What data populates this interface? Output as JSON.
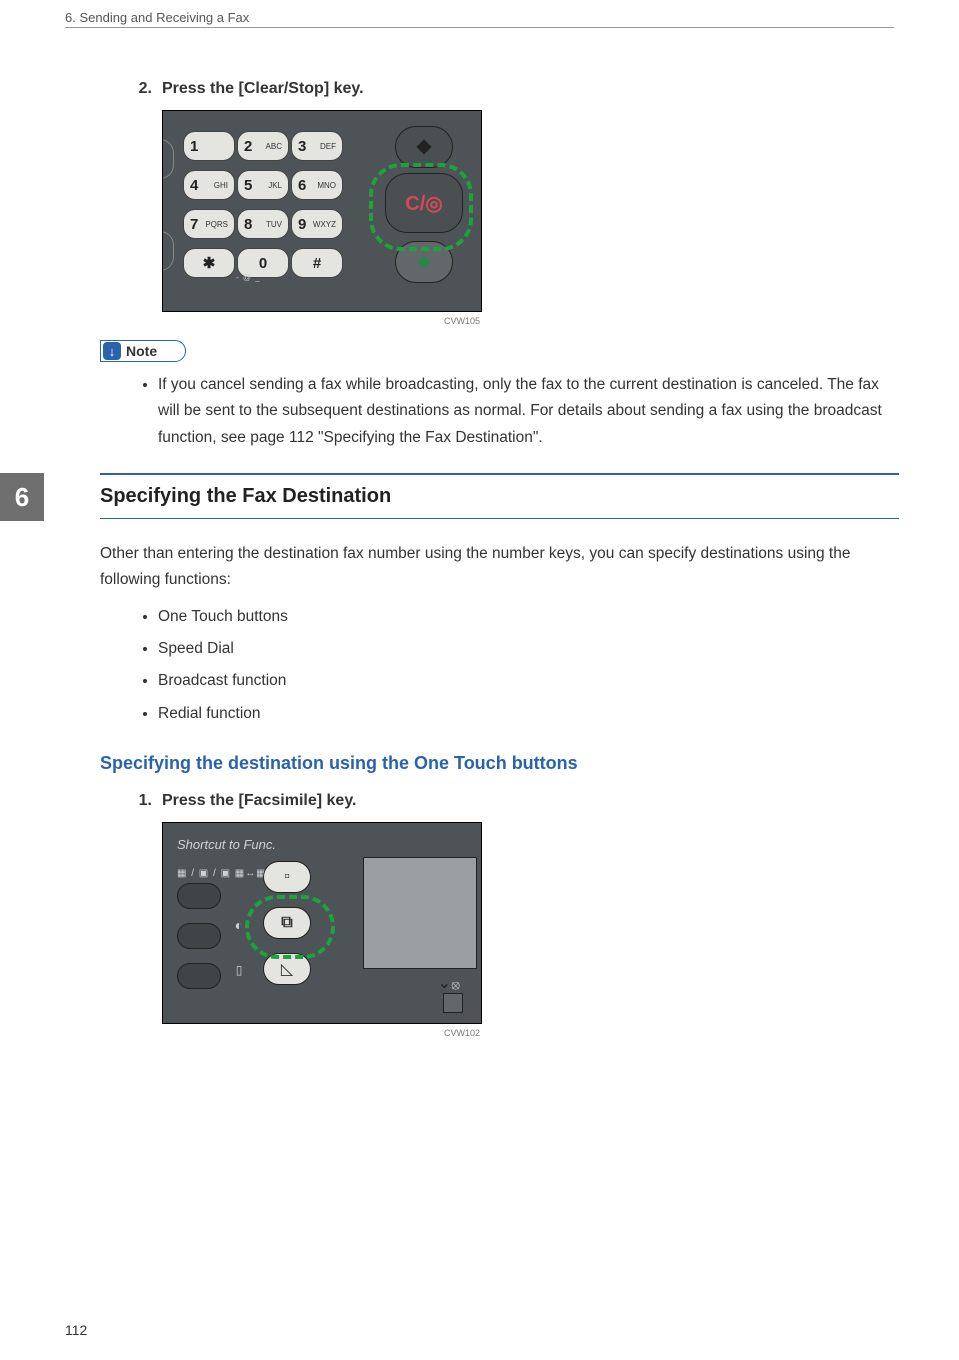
{
  "running_head": "6. Sending and Receiving a Fax",
  "step_a": {
    "num": "2.",
    "text": "Press the [Clear/Stop] key."
  },
  "fig1": {
    "caption": "CVW105",
    "keys": [
      {
        "n": "1",
        "l": ""
      },
      {
        "n": "2",
        "l": "ABC"
      },
      {
        "n": "3",
        "l": "DEF"
      },
      {
        "n": "4",
        "l": "GHI"
      },
      {
        "n": "5",
        "l": "JKL"
      },
      {
        "n": "6",
        "l": "MNO"
      },
      {
        "n": "7",
        "l": "PQRS"
      },
      {
        "n": "8",
        "l": "TUV"
      },
      {
        "n": "9",
        "l": "WXYZ"
      },
      {
        "n": "✱",
        "l": ""
      },
      {
        "n": "0",
        "l": ""
      },
      {
        "n": "#",
        "l": ""
      }
    ],
    "under0": "- @ _",
    "clear_label": "C/◎"
  },
  "note": {
    "label": "Note",
    "items": [
      "If you cancel sending a fax while broadcasting, only the fax to the current destination is canceled. The fax will be sent to the subsequent destinations as normal. For details about sending a fax using the broadcast function, see page 112 \"Specifying the Fax Destination\"."
    ]
  },
  "chapter_tab": "6",
  "section_title": "Specifying the Fax Destination",
  "intro_para": "Other than entering the destination fax number using the number keys, you can specify destinations using the following functions:",
  "func_list": [
    "One Touch buttons",
    "Speed Dial",
    "Broadcast function",
    "Redial function"
  ],
  "subhead": "Specifying the destination using the One Touch buttons",
  "step_b": {
    "num": "1.",
    "text": "Press the [Facsimile] key."
  },
  "fig2": {
    "caption": "CVW102",
    "shortcut_label": "Shortcut to Func.",
    "icon_line": "▦ / ▣ / ▣  ▦↔▦",
    "mid_glyphs": {
      "copy": "▫",
      "fax": "⧉",
      "scan": "◺"
    },
    "side": {
      "density": "◐",
      "paper": "▯"
    },
    "chev": "⌄",
    "lock": "⦻"
  },
  "page_number": "112"
}
